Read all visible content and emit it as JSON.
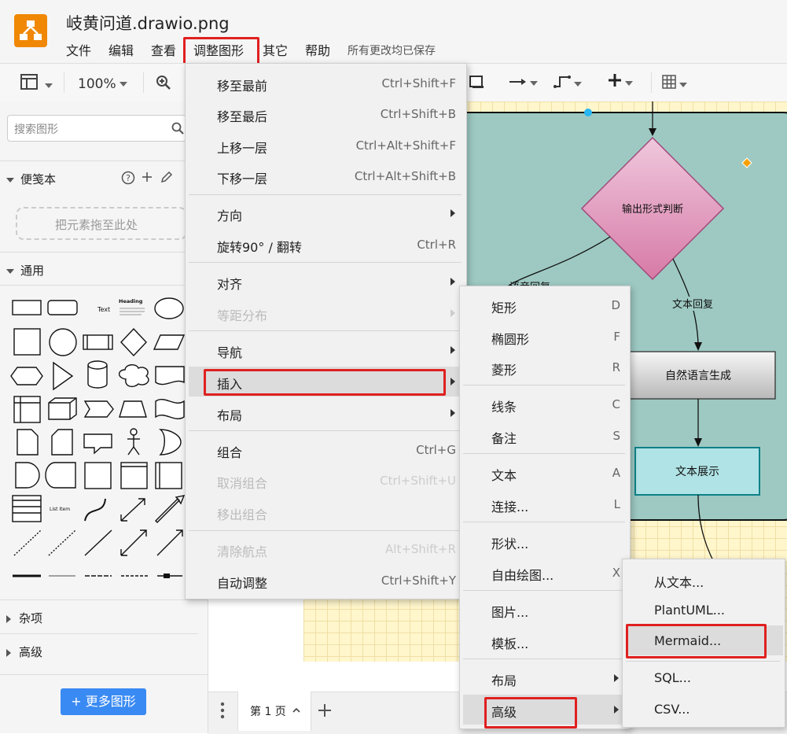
{
  "title": "岐黄问道.drawio.png",
  "menubar": [
    "文件",
    "编辑",
    "查看",
    "调整图形",
    "其它",
    "帮助"
  ],
  "save_status": "所有更改均已保存",
  "toolbar": {
    "zoom": "100%"
  },
  "sidebar": {
    "search_placeholder": "搜索图形",
    "scratchpad_title": "便笺本",
    "drop_zone": "把元素拖至此处",
    "general_title": "通用",
    "misc_title": "杂项",
    "advanced_title": "高级",
    "shape_text": "Text",
    "shape_heading": "Heading",
    "shape_list_item": "List Item",
    "more_shapes": "+ 更多图形"
  },
  "canvas": {
    "diamond": "输出形式判断",
    "edge_label_1": "文本回复",
    "edge_label_2": "语音回复",
    "box_nlg": "自然语言生成",
    "box_display": "文本展示",
    "colors": {
      "container": "#9dc9c2",
      "diamond": "#e0a0c0",
      "display": "#b0e3e6",
      "grid": "#fff6cc"
    }
  },
  "page_bar": {
    "page_tab": "第 1 页"
  },
  "arrange_menu": [
    {
      "label": "移至最前",
      "shortcut": "Ctrl+Shift+F"
    },
    {
      "label": "移至最后",
      "shortcut": "Ctrl+Shift+B"
    },
    {
      "label": "上移一层",
      "shortcut": "Ctrl+Alt+Shift+F"
    },
    {
      "label": "下移一层",
      "shortcut": "Ctrl+Alt+Shift+B"
    },
    {
      "label": "方向",
      "shortcut": ""
    },
    {
      "label": "旋转90° / 翻转",
      "shortcut": "Ctrl+R"
    },
    {
      "label": "对齐",
      "shortcut": ""
    },
    {
      "label": "等距分布",
      "shortcut": ""
    },
    {
      "label": "导航",
      "shortcut": ""
    },
    {
      "label": "插入",
      "shortcut": ""
    },
    {
      "label": "布局",
      "shortcut": ""
    },
    {
      "label": "组合",
      "shortcut": "Ctrl+G"
    },
    {
      "label": "取消组合",
      "shortcut": "Ctrl+Shift+U"
    },
    {
      "label": "移出组合",
      "shortcut": ""
    },
    {
      "label": "清除航点",
      "shortcut": "Alt+Shift+R"
    },
    {
      "label": "自动调整",
      "shortcut": "Ctrl+Shift+Y"
    }
  ],
  "insert_menu": [
    {
      "label": "矩形",
      "shortcut": "D"
    },
    {
      "label": "椭圆形",
      "shortcut": "F"
    },
    {
      "label": "菱形",
      "shortcut": "R"
    },
    {
      "label": "线条",
      "shortcut": "C"
    },
    {
      "label": "备注",
      "shortcut": "S"
    },
    {
      "label": "文本",
      "shortcut": "A"
    },
    {
      "label": "连接...",
      "shortcut": "L"
    },
    {
      "label": "形状...",
      "shortcut": ""
    },
    {
      "label": "自由绘图...",
      "shortcut": "X"
    },
    {
      "label": "图片...",
      "shortcut": ""
    },
    {
      "label": "模板...",
      "shortcut": ""
    },
    {
      "label": "布局",
      "shortcut": ""
    },
    {
      "label": "高级",
      "shortcut": ""
    }
  ],
  "advanced_menu": [
    {
      "label": "从文本..."
    },
    {
      "label": "PlantUML..."
    },
    {
      "label": "Mermaid..."
    },
    {
      "label": "SQL..."
    },
    {
      "label": "CSV..."
    }
  ]
}
